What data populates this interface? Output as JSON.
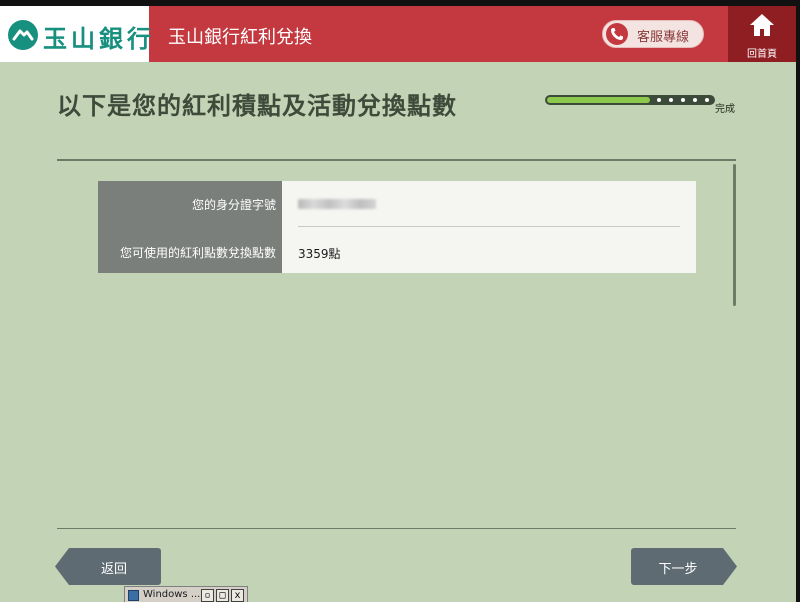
{
  "header": {
    "logo_text": "玉山銀行",
    "title": "玉山銀行紅利兌換",
    "service_label": "客服專線",
    "home_label": "回首頁"
  },
  "page": {
    "title": "以下是您的紅利積點及活動兌換點數",
    "progress_label": "完成",
    "progress_fraction": 0.62
  },
  "info": {
    "id_label": "您的身分證字號",
    "points_label": "您可使用的紅利點數兌換點數",
    "points_value": "3359點"
  },
  "nav": {
    "back_label": "返回",
    "next_label": "下一步"
  },
  "taskbar": {
    "window_label": "Windows ...",
    "restore_glyph": "▫",
    "maximize_glyph": "□",
    "close_glyph": "x"
  },
  "colors": {
    "header_red": "#c4393f",
    "home_red": "#8f1e23",
    "brand_green": "#17907f",
    "background": "#c3d3b5",
    "button_gray": "#5f6b73",
    "progress_green": "#8cc84b"
  },
  "icons": {
    "logo": "mountain-logo-icon",
    "service": "phone-icon",
    "home": "home-icon"
  }
}
